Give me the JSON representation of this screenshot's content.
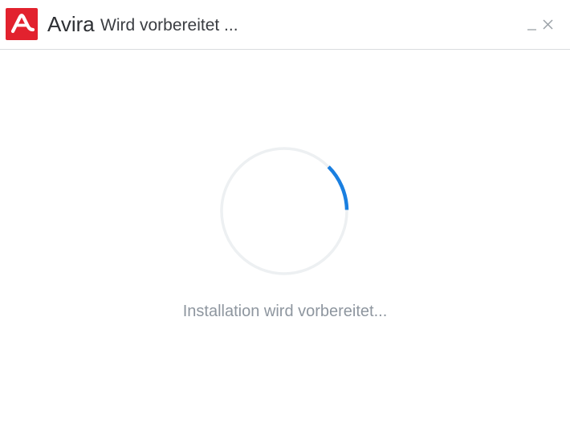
{
  "window": {
    "brand": "Avira",
    "title": "Wird vorbereitet ...",
    "brand_color": "#e2222e",
    "controls": [
      "minimize-icon",
      "close-icon"
    ]
  },
  "main": {
    "spinner": {
      "track_color": "#edf0f2",
      "arc_color": "#1a7fe0"
    },
    "status_text": "Installation wird vorbereitet..."
  }
}
